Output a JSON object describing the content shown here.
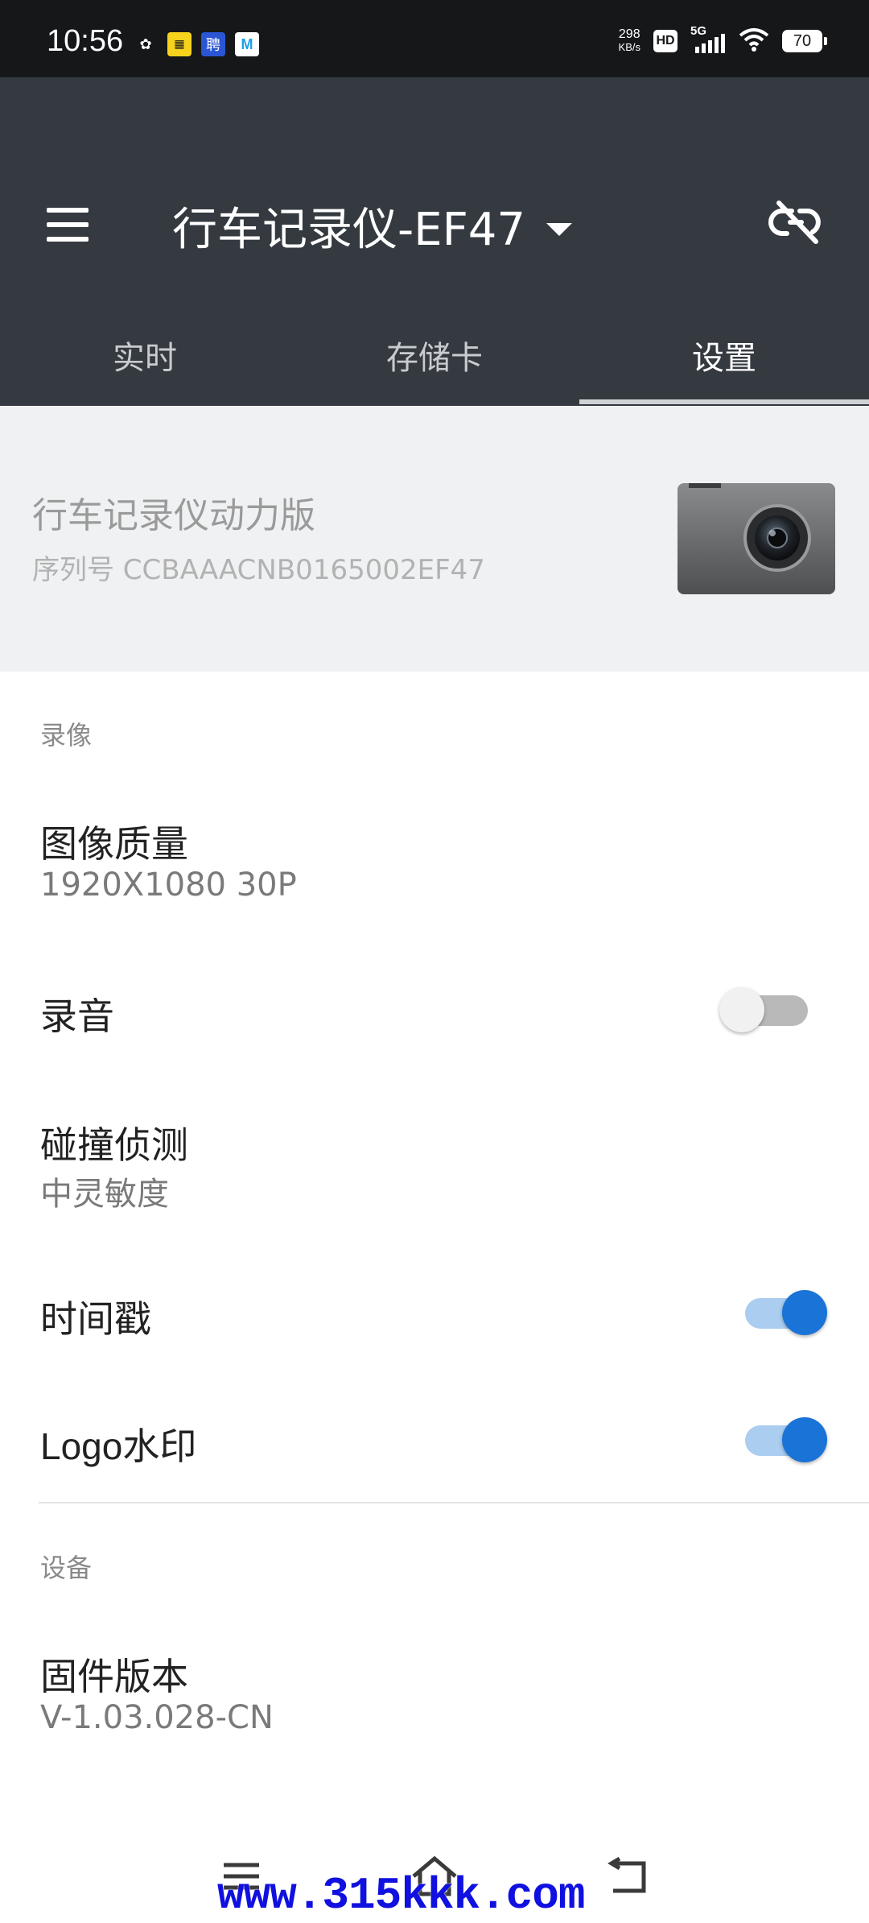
{
  "status_bar": {
    "time": "10:56",
    "apps": [
      {
        "icon": "wechat-icon",
        "glyph": "✿",
        "color": "#ffffff"
      },
      {
        "icon": "mtime-icon",
        "glyph": "█",
        "color": "#f6d21d"
      },
      {
        "icon": "recruit-icon",
        "glyph": "聘",
        "color": "#2a56d6"
      },
      {
        "icon": "m-app-icon",
        "glyph": "M",
        "color": "#1aa0e8"
      }
    ],
    "net_speed_value": "298",
    "net_speed_unit": "KB/s",
    "hd_label": "HD",
    "signal_label": "5G",
    "battery": "70"
  },
  "app_bar": {
    "title": "行车记录仪-EF47",
    "tabs": [
      {
        "label": "实时",
        "active": false
      },
      {
        "label": "存储卡",
        "active": false
      },
      {
        "label": "设置",
        "active": true
      }
    ]
  },
  "device": {
    "name": "行车记录仪动力版",
    "serial": "序列号 CCBAAACNB0165002EF47"
  },
  "sections": {
    "recording_header": "录像",
    "device_header": "设备"
  },
  "settings": {
    "image_quality": {
      "title": "图像质量",
      "value": "1920X1080 30P"
    },
    "audio": {
      "title": "录音",
      "enabled": false
    },
    "collision": {
      "title": "碰撞侦测",
      "value": "中灵敏度"
    },
    "timestamp": {
      "title": "时间戳",
      "enabled": true
    },
    "logo_watermark": {
      "title": "Logo水印",
      "enabled": true
    },
    "firmware": {
      "title": "固件版本",
      "value": "V-1.03.028-CN"
    }
  },
  "watermark": "www.315kkk.com",
  "colors": {
    "app_bar": "#343a40",
    "accent": "#1a73d6",
    "card_bg": "#f0f1f2"
  }
}
